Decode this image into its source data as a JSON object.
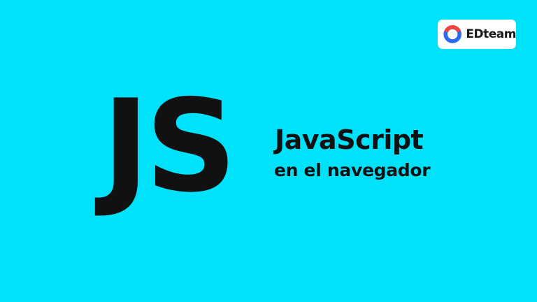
{
  "colors": {
    "background": "#00E2FA",
    "text": "#111111",
    "logo_red": "#F0443C",
    "logo_blue": "#2C6BF0"
  },
  "hero": {
    "mark": "JS",
    "title": "JavaScript",
    "subtitle": "en el navegador"
  },
  "brand": {
    "logo_icon": "edteam-ring-icon",
    "name": "EDteam"
  }
}
